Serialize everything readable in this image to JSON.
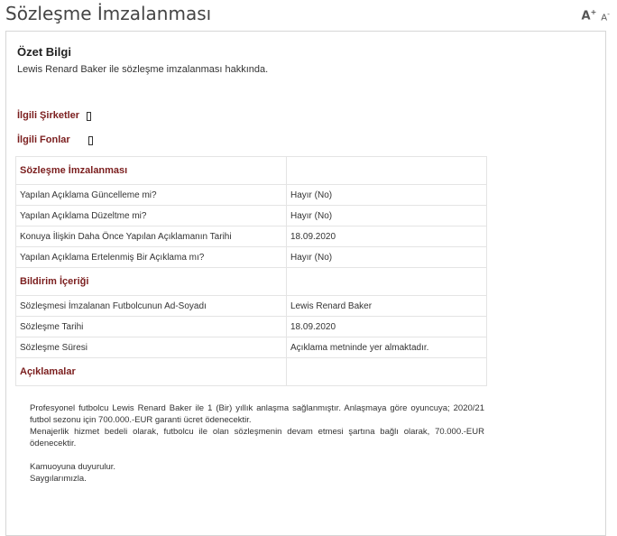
{
  "header": {
    "title": "Sözleşme İmzalanması",
    "font_increase": "A",
    "font_increase_sup": "+",
    "font_decrease": "A",
    "font_decrease_sup": "-"
  },
  "summary": {
    "title": "Özet Bilgi",
    "text": "Lewis Renard Baker ile sözleşme imzalanması hakkında."
  },
  "related": {
    "companies_label": "İlgili Şirketler",
    "funds_label": "İlgili Fonlar"
  },
  "table": {
    "section_title": "Sözleşme İmzalanması",
    "rows": [
      {
        "label": "Yapılan Açıklama Güncelleme mi?",
        "value": "Hayır (No)"
      },
      {
        "label": "Yapılan Açıklama Düzeltme mi?",
        "value": "Hayır (No)"
      },
      {
        "label": "Konuya İlişkin Daha Önce Yapılan Açıklamanın Tarihi",
        "value": "18.09.2020"
      },
      {
        "label": "Yapılan Açıklama Ertelenmiş Bir Açıklama mı?",
        "value": "Hayır (No)"
      }
    ],
    "notification_title": "Bildirim İçeriği",
    "notification_rows": [
      {
        "label": "Sözleşmesi İmzalanan Futbolcunun Ad-Soyadı",
        "value": "Lewis Renard Baker"
      },
      {
        "label": "Sözleşme Tarihi",
        "value": "18.09.2020"
      },
      {
        "label": "Sözleşme Süresi",
        "value": "Açıklama metninde yer almaktadır."
      }
    ],
    "notes_title": "Açıklamalar"
  },
  "body": {
    "p1": "Profesyonel futbolcu Lewis Renard Baker ile 1 (Bir) yıllık anlaşma sağlanmıştır. Anlaşmaya göre oyuncuya; 2020/21 futbol sezonu için 700.000.-EUR garanti ücret ödenecektir.",
    "p2": "Menajerlik hizmet bedeli olarak, futbolcu ile olan sözleşmenin devam etmesi şartına bağlı olarak, 70.000.-EUR ödenecektir.",
    "p3": "Kamuoyuna duyurulur.",
    "p4": "Saygılarımızla."
  },
  "colors": {
    "accent": "#7b1e1e",
    "border": "#e4e4e4"
  }
}
